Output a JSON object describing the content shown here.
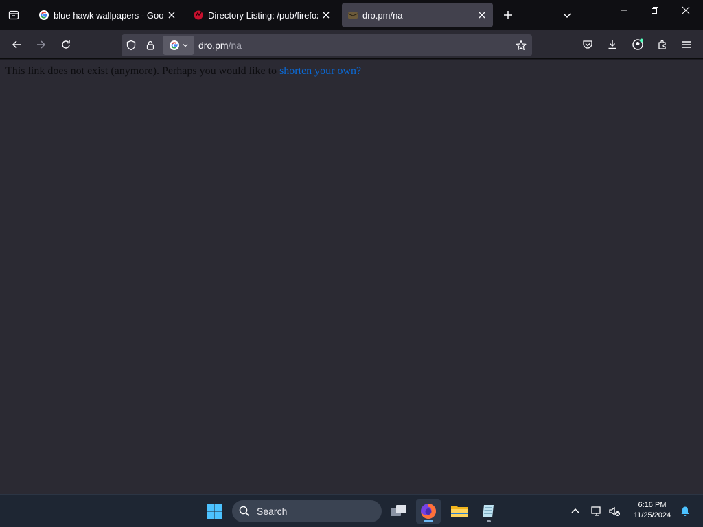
{
  "browser": {
    "tabs": [
      {
        "title": "blue hawk wallpapers - Google",
        "favicon": "google-icon",
        "active": false
      },
      {
        "title": "Directory Listing: /pub/firefox/n",
        "favicon": "mozilla-dino-icon",
        "active": false
      },
      {
        "title": "dro.pm/na",
        "favicon": "dro-pm-icon",
        "active": true
      }
    ],
    "url": {
      "host": "dro.pm",
      "path": "/na"
    },
    "search_engine": "google-icon"
  },
  "page": {
    "message": "This link does not exist (anymore). Perhaps you would like to ",
    "link_text": "shorten your own?"
  },
  "taskbar": {
    "search_label": "Search",
    "time": "6:16 PM",
    "date": "11/25/2024"
  },
  "colors": {
    "accent": "#0a6ad7",
    "toolbar": "#2b2a33",
    "tabstrip": "#0f0f13",
    "taskbar": "#1e2633"
  }
}
